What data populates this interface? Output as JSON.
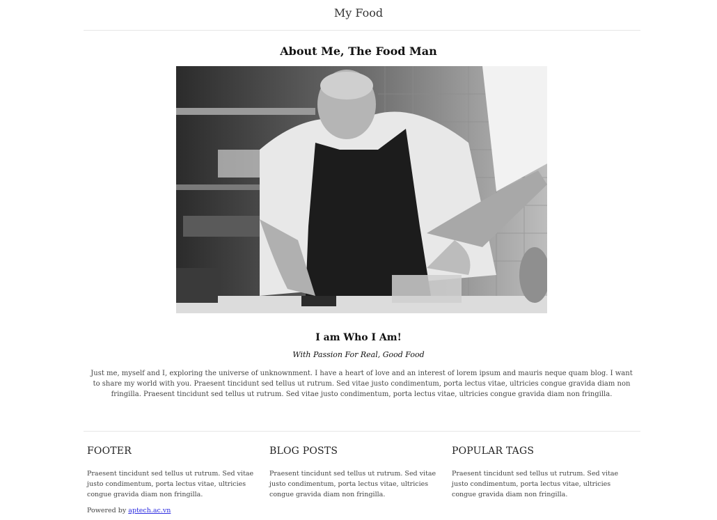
{
  "header": {
    "site_title": "My Food"
  },
  "main": {
    "title": "About Me, The Food Man",
    "hero_image_alt": "Chef in apron preparing food in a kitchen (black and white)",
    "subtitle": "I am Who I Am!",
    "tagline": "With Passion For Real, Good Food",
    "bio": "Just me, myself and I, exploring the universe of unknownment. I have a heart of love and an interest of lorem ipsum and mauris neque quam blog. I want to share my world with you. Praesent tincidunt sed tellus ut rutrum. Sed vitae justo condimentum, porta lectus vitae, ultricies congue gravida diam non fringilla. Praesent tincidunt sed tellus ut rutrum. Sed vitae justo condimentum, porta lectus vitae, ultricies congue gravida diam non fringilla."
  },
  "footer": {
    "columns": [
      {
        "title": "FOOTER",
        "text": "Praesent tincidunt sed tellus ut rutrum. Sed vitae justo condimentum, porta lectus vitae, ultricies congue gravida diam non fringilla."
      },
      {
        "title": "BLOG POSTS",
        "text": "Praesent tincidunt sed tellus ut rutrum. Sed vitae justo condimentum, porta lectus vitae, ultricies congue gravida diam non fringilla."
      },
      {
        "title": "POPULAR TAGS",
        "text": "Praesent tincidunt sed tellus ut rutrum. Sed vitae justo condimentum, porta lectus vitae, ultricies congue gravida diam non fringilla."
      }
    ],
    "powered_prefix": "Powered by",
    "powered_link": "aptech.ac.vn"
  },
  "colors": {
    "link": "#2a2ae0",
    "rule": "#e6e6e6"
  }
}
